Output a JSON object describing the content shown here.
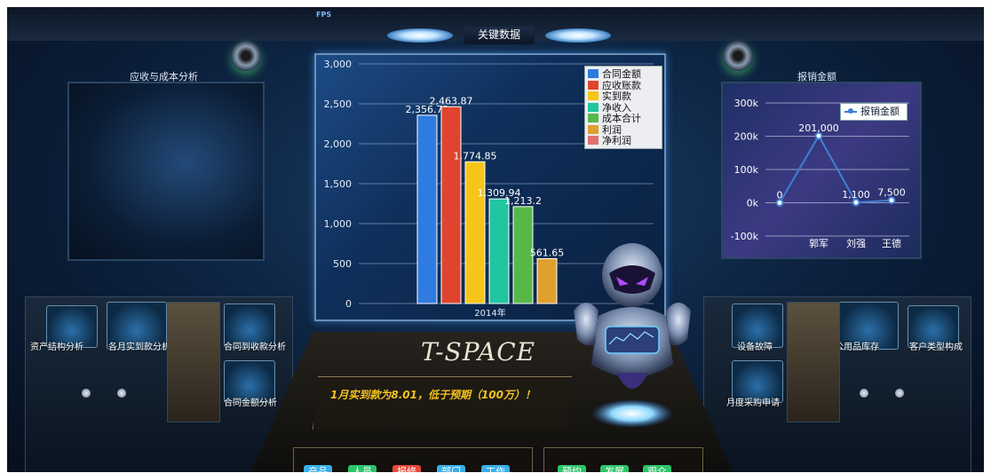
{
  "hud": {
    "fps_label": "FPS",
    "center_title": "关键数据"
  },
  "left_panel": {
    "title": "应收与成本分析"
  },
  "right_panel": {
    "title": "报销金额"
  },
  "chart_data": [
    {
      "type": "bar",
      "title": "",
      "categories": [
        "2014年"
      ],
      "ylim": [
        0,
        3000
      ],
      "y_ticks": [
        0,
        500,
        1000,
        1500,
        2000,
        2500,
        3000
      ],
      "y_tick_labels": [
        "0",
        "500",
        "1,000",
        "1,500",
        "2,000",
        "2,500",
        "3,000"
      ],
      "legend_position": "top-right",
      "series": [
        {
          "name": "合同金额",
          "values": [
            2356.72
          ],
          "label": "2,356.72",
          "color": "#2f7be0"
        },
        {
          "name": "应收账款",
          "values": [
            2463.87
          ],
          "label": "2,463.87",
          "color": "#e0442e"
        },
        {
          "name": "实到款",
          "values": [
            1774.85
          ],
          "label": "1,774.85",
          "color": "#f5c518"
        },
        {
          "name": "净收入",
          "values": [
            1309.94
          ],
          "label": "1,309.94",
          "color": "#1fc6a0"
        },
        {
          "name": "成本合计",
          "values": [
            1213.2
          ],
          "label": "1,213.2",
          "color": "#57b84a"
        },
        {
          "name": "利润",
          "values": [
            561.65
          ],
          "label": "561.65",
          "color": "#e0a030"
        },
        {
          "name": "净利润",
          "values": [],
          "label": "",
          "color": "#e07070"
        }
      ]
    },
    {
      "type": "line",
      "categories": [
        "",
        "郭军",
        "刘强",
        "王德"
      ],
      "ylim": [
        -100000,
        300000
      ],
      "y_ticks": [
        -100000,
        0,
        100000,
        200000,
        300000
      ],
      "y_tick_labels": [
        "-100k",
        "0k",
        "100k",
        "200k",
        "300k"
      ],
      "legend_position": "top-right",
      "series": [
        {
          "name": "报销金额",
          "values": [
            0,
            201000,
            1100,
            7500
          ],
          "labels": [
            "0",
            "201,000",
            "1,100",
            "7,500"
          ],
          "color": "#3f7fd6"
        }
      ]
    }
  ],
  "gauges": {
    "left": [
      "资产结构分析",
      "各月实到款分析",
      "合同到收款分析",
      "合同金额分析"
    ],
    "right": [
      "设备故障",
      "办公用品库存",
      "客户类型构成",
      "月度采购申请"
    ]
  },
  "console": {
    "brand": "T-SPACE",
    "alert": "1月实到款为8.01，低于预期（100万）！",
    "buttons_left": [
      {
        "label": "产品",
        "color": "#3aaee8"
      },
      {
        "label": "人员",
        "color": "#2cc46a"
      },
      {
        "label": "报修",
        "color": "#e44a3a"
      },
      {
        "label": "部门",
        "color": "#3aaee8"
      },
      {
        "label": "工作",
        "color": "#3aaee8"
      }
    ],
    "buttons_right": [
      {
        "label": "预约",
        "color": "#2cc46a"
      },
      {
        "label": "发展",
        "color": "#2cc46a"
      },
      {
        "label": "观众",
        "color": "#2cc46a"
      }
    ]
  }
}
